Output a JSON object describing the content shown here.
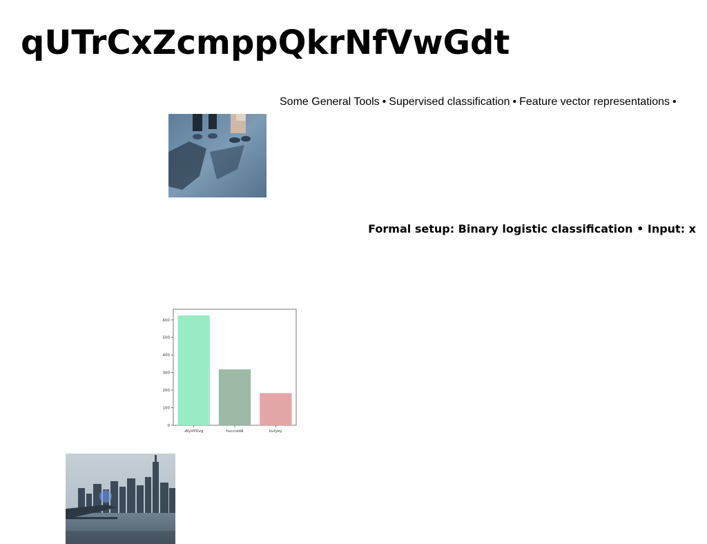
{
  "document": {
    "title": "qUTrCxZcmppQkrNfVwGdt",
    "tools_items": [
      "Some General Tools",
      "Supervised classification",
      "Feature vector representations"
    ],
    "separator": "•",
    "setup_line": "Formal setup: Binary logistic classification • Input: x"
  },
  "images": {
    "photo_1": {
      "subject": "feet-and-shadows-photo"
    },
    "photo_2": {
      "subject": "city-skyline-photo"
    }
  },
  "chart_data": {
    "type": "bar",
    "categories": [
      "zKyVPDvg",
      "hvccoldA",
      "kutyey"
    ],
    "values": [
      625,
      318,
      183
    ],
    "colors": [
      "#99ebc3",
      "#9cbaa5",
      "#e4a7a9"
    ],
    "ylim": [
      0,
      660
    ],
    "yticks": [
      0,
      100,
      200,
      300,
      400,
      500,
      600
    ],
    "title": "",
    "xlabel": "",
    "ylabel": ""
  }
}
